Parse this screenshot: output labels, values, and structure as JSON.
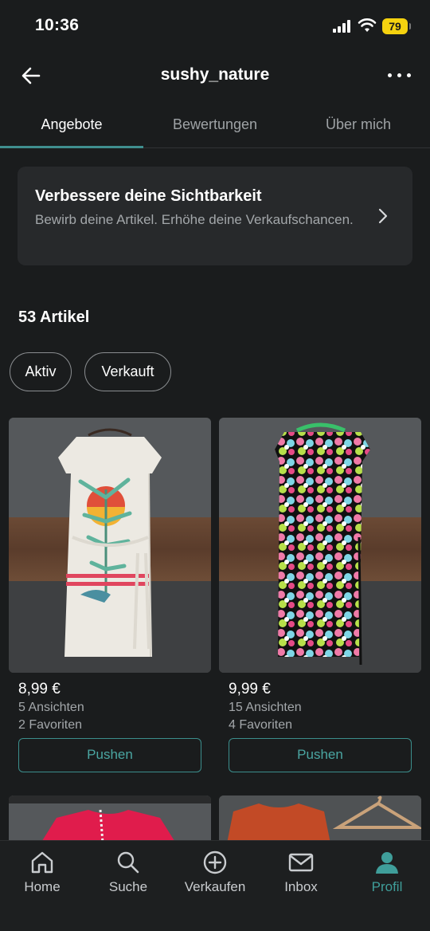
{
  "status": {
    "time": "10:36",
    "battery": "79"
  },
  "header": {
    "title": "sushy_nature"
  },
  "tabs": [
    {
      "label": "Angebote",
      "active": true
    },
    {
      "label": "Bewertungen",
      "active": false
    },
    {
      "label": "Über mich",
      "active": false
    }
  ],
  "promo": {
    "title": "Verbessere deine Sichtbarkeit",
    "text": "Bewirb deine Artikel. Erhöhe deine Verkaufschancen."
  },
  "items_count": "53 Artikel",
  "filters": [
    "Aktiv",
    "Verkauft"
  ],
  "items": [
    {
      "price": "8,99 €",
      "views": "5 Ansichten",
      "favorites": "2 Favoriten",
      "push_label": "Pushen"
    },
    {
      "price": "9,99 €",
      "views": "15 Ansichten",
      "favorites": "4 Favoriten",
      "push_label": "Pushen"
    }
  ],
  "bottom_nav": [
    {
      "label": "Home",
      "icon": "home-icon"
    },
    {
      "label": "Suche",
      "icon": "search-icon"
    },
    {
      "label": "Verkaufen",
      "icon": "plus-circle-icon"
    },
    {
      "label": "Inbox",
      "icon": "mail-icon"
    },
    {
      "label": "Profil",
      "icon": "person-icon",
      "active": true
    }
  ],
  "colors": {
    "accent": "#3f8f8f",
    "background": "#1a1c1d",
    "battery": "#f5d20f"
  }
}
